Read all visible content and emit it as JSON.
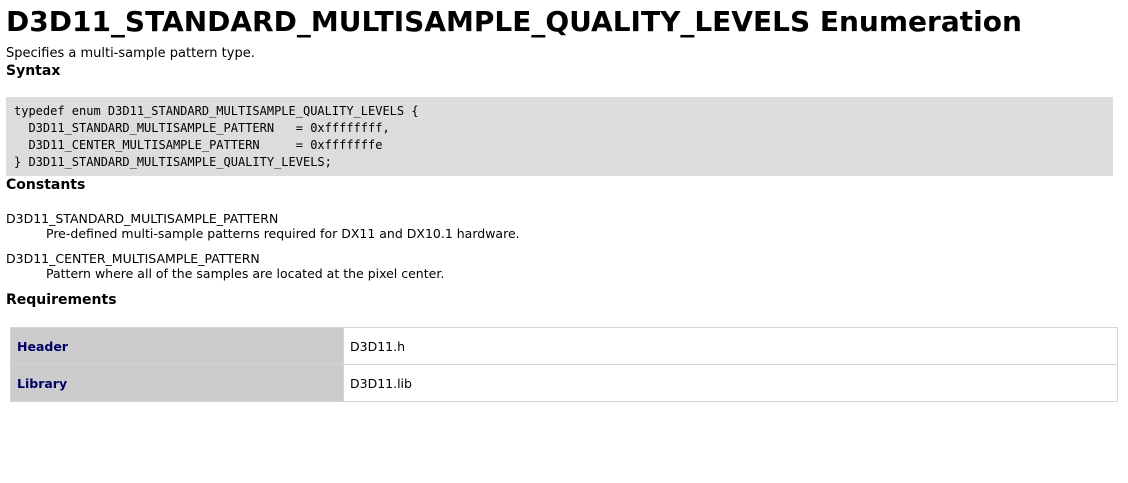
{
  "title": "D3D11_STANDARD_MULTISAMPLE_QUALITY_LEVELS Enumeration",
  "summary": "Specifies a multi-sample pattern type.",
  "syntax": {
    "heading": "Syntax",
    "code_lines": [
      "typedef enum D3D11_STANDARD_MULTISAMPLE_QUALITY_LEVELS {",
      "  D3D11_STANDARD_MULTISAMPLE_PATTERN   = 0xffffffff,",
      "  D3D11_CENTER_MULTISAMPLE_PATTERN     = 0xfffffffe",
      "} D3D11_STANDARD_MULTISAMPLE_QUALITY_LEVELS;"
    ]
  },
  "constants": {
    "heading": "Constants",
    "items": [
      {
        "name": "D3D11_STANDARD_MULTISAMPLE_PATTERN",
        "description": "Pre-defined multi-sample patterns required for DX11 and DX10.1 hardware."
      },
      {
        "name": "D3D11_CENTER_MULTISAMPLE_PATTERN",
        "description": "Pattern where all of the samples are located at the pixel center."
      }
    ]
  },
  "requirements": {
    "heading": "Requirements",
    "rows": [
      {
        "key": "Header",
        "value": "D3D11.h"
      },
      {
        "key": "Library",
        "value": "D3D11.lib"
      }
    ]
  },
  "colors": {
    "code_background": "#dddddd",
    "requirements_key_background": "#cccccc",
    "requirements_key_text": "#000066"
  }
}
